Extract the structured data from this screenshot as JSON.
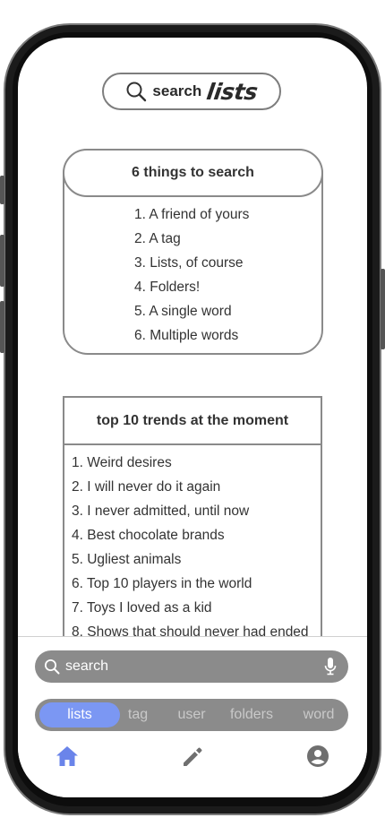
{
  "header": {
    "search_word": "search",
    "lists_word": "lists"
  },
  "things_box": {
    "title": "6 things to search",
    "items": [
      "1. A friend of yours",
      "2. A tag",
      "3. Lists, of course",
      "4. Folders!",
      "5. A single word",
      "6. Multiple words"
    ]
  },
  "trends_box": {
    "title": "top 10 trends at the moment",
    "items": [
      "1. Weird desires",
      "2. I will never do it again",
      "3. I never admitted, until now",
      "4. Best chocolate brands",
      "5. Ugliest animals",
      "6. Top 10 players in the world",
      "7. Toys I loved as a kid",
      "8. Shows that should never had ended"
    ]
  },
  "search_bar": {
    "placeholder": "search"
  },
  "segments": {
    "items": [
      "lists",
      "tag",
      "user",
      "folders",
      "word"
    ],
    "active": "lists"
  },
  "bottom_nav": {
    "items": [
      "home-icon",
      "pencil-icon",
      "profile-icon"
    ],
    "active": "home-icon"
  },
  "colors": {
    "accent": "#7b97f3",
    "nav_active": "#6a84ea",
    "nav_inactive": "#6f6f6f",
    "pill_bg": "#8b8b8b"
  }
}
